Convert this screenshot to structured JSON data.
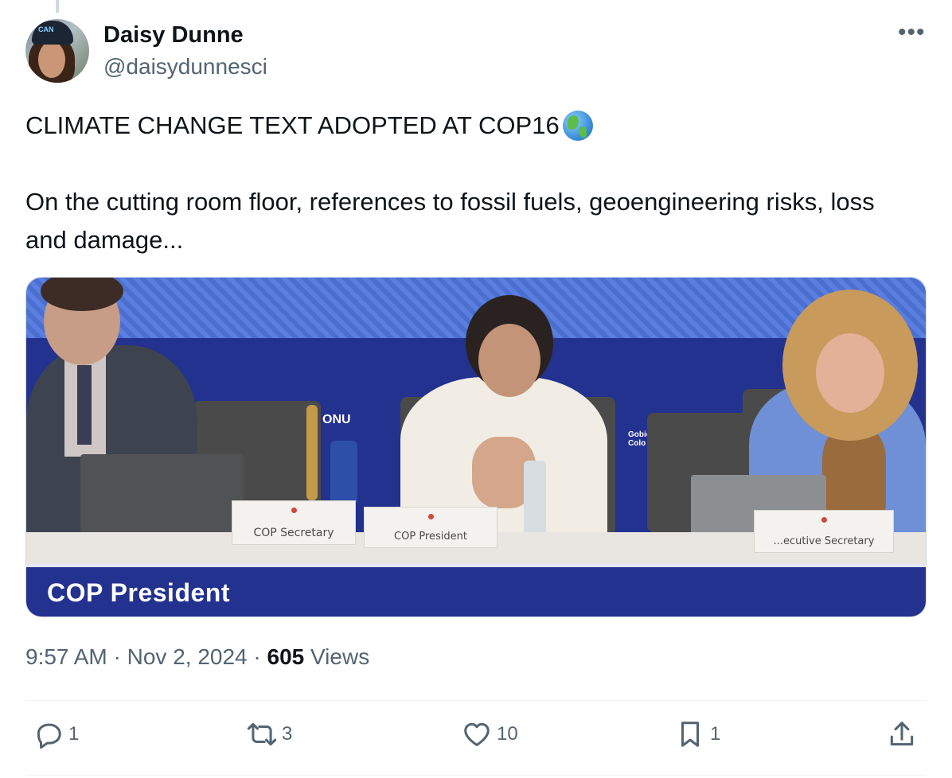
{
  "author": {
    "name": "Daisy Dunne",
    "handle": "@daisydunnesci",
    "avatar_hat_text": "CAN"
  },
  "more_label": "•••",
  "tweet": {
    "line1": "CLIMATE CHANGE TEXT ADOPTED AT COP16",
    "line1_emoji": "globe-americas-icon",
    "body": "On the cutting room floor, references to fossil fuels, geoengineering risks, loss and damage..."
  },
  "media": {
    "lower_third": "COP President",
    "placards": {
      "left": "COP Secretary",
      "center": "COP President",
      "right": "...ecutive Secretary"
    },
    "backdrop_sign": "ONU",
    "backdrop_sign_right": "Gobie Colo"
  },
  "meta": {
    "time": "9:57 AM",
    "date": "Nov 2, 2024",
    "views_count": "605",
    "views_label": "Views",
    "separator": "·"
  },
  "actions": {
    "reply_count": "1",
    "retweet_count": "3",
    "like_count": "10",
    "bookmark_count": "1"
  },
  "colors": {
    "text": "#0f1419",
    "muted": "#536471",
    "lower_third_bg": "#23318f"
  }
}
